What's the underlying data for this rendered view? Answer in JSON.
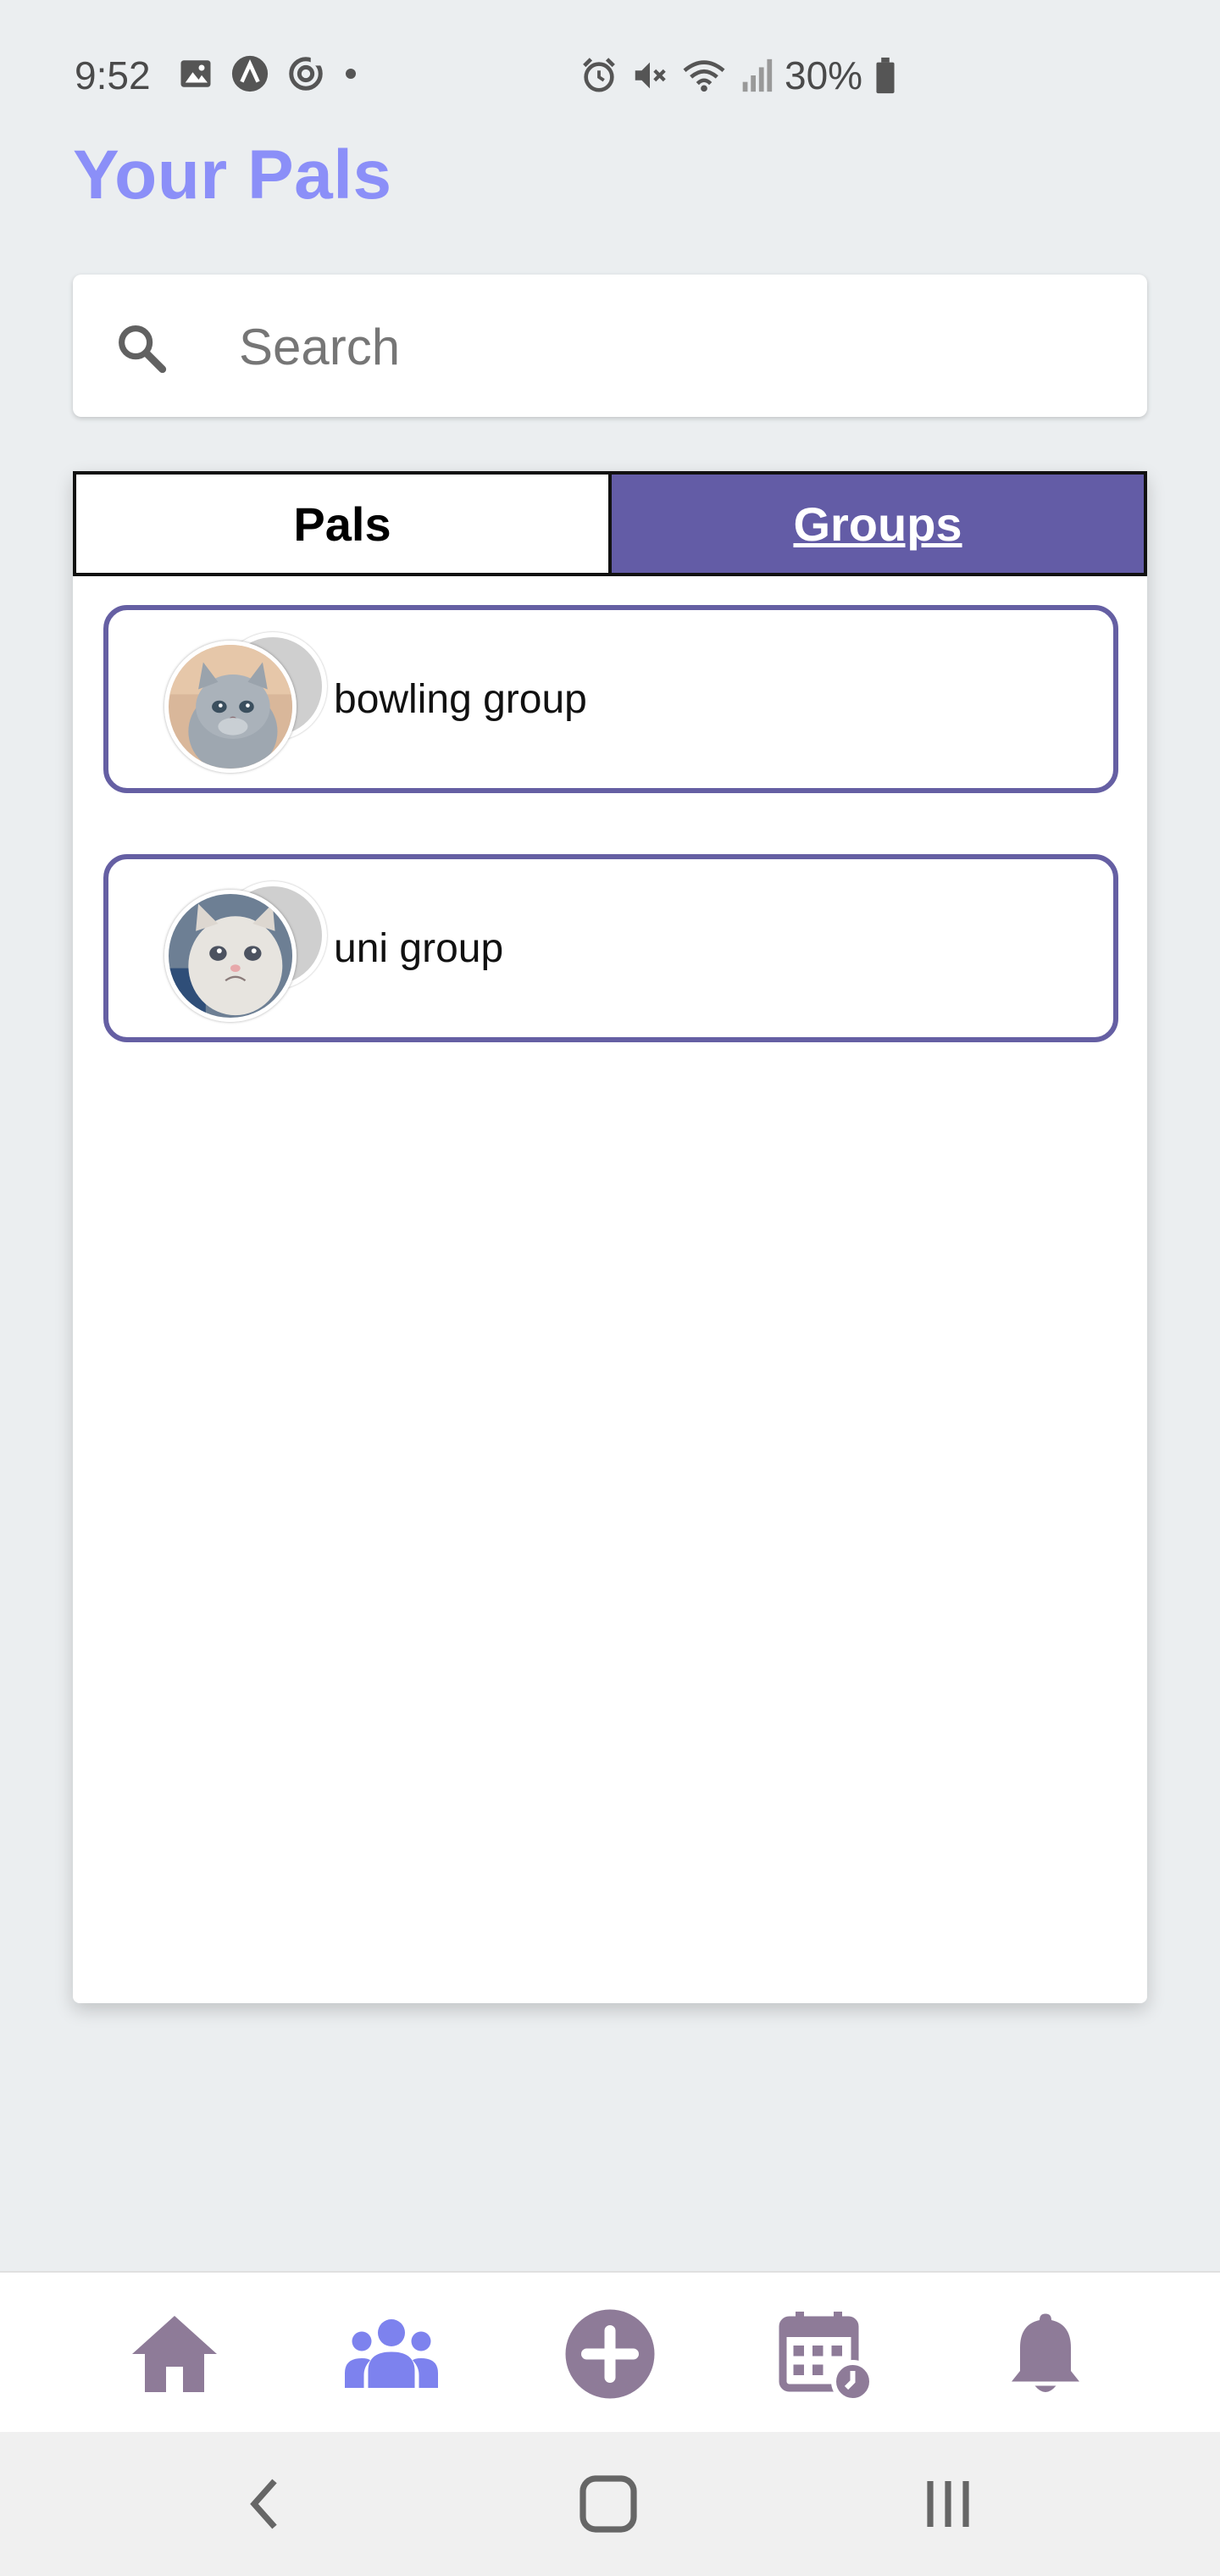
{
  "status_bar": {
    "time": "9:52",
    "battery": "30%"
  },
  "title": "Your Pals",
  "search": {
    "placeholder": "Search",
    "value": ""
  },
  "tabs": [
    {
      "label": "Pals",
      "active": false
    },
    {
      "label": "Groups",
      "active": true
    }
  ],
  "groups": [
    {
      "name": "bowling group",
      "avatar": "grey-kitten-photo"
    },
    {
      "name": "uni group",
      "avatar": "crying-cat-photo"
    }
  ],
  "bottom_nav": [
    {
      "icon": "home-icon",
      "active": false
    },
    {
      "icon": "people-icon",
      "active": true
    },
    {
      "icon": "add-circle-icon",
      "active": false
    },
    {
      "icon": "calendar-clock-icon",
      "active": false
    },
    {
      "icon": "bell-icon",
      "active": false
    }
  ],
  "system_nav": [
    "back-icon",
    "home-square-icon",
    "recents-icon"
  ],
  "colors": {
    "accent": "#8b8ff8",
    "tab_active_bg": "#635ca6",
    "card_border": "#655fa3",
    "nav_icon": "#8e7b98",
    "nav_icon_active": "#7d82ee",
    "background": "#ebeef0"
  }
}
